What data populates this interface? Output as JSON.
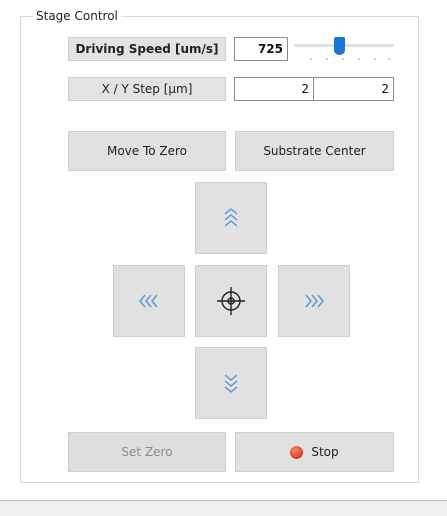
{
  "group": {
    "title": "Stage Control"
  },
  "speed": {
    "label": "Driving Speed [um/s]",
    "value": "725",
    "slider_fraction": 0.45
  },
  "step": {
    "label": "X / Y Step [µm]",
    "x_value": "2",
    "y_value": "2"
  },
  "buttons": {
    "move_to_zero": "Move To Zero",
    "substrate_center": "Substrate Center",
    "set_zero": "Set Zero",
    "stop": "Stop"
  },
  "jog_icons": {
    "up": "triple-chevron-up-icon",
    "down": "triple-chevron-down-icon",
    "left": "triple-chevron-left-icon",
    "right": "triple-chevron-right-icon",
    "center": "crosshair-icon"
  },
  "colors": {
    "accent": "#1a73d9",
    "stop_dot": "#e0391a",
    "arrow": "#5b93d6"
  }
}
